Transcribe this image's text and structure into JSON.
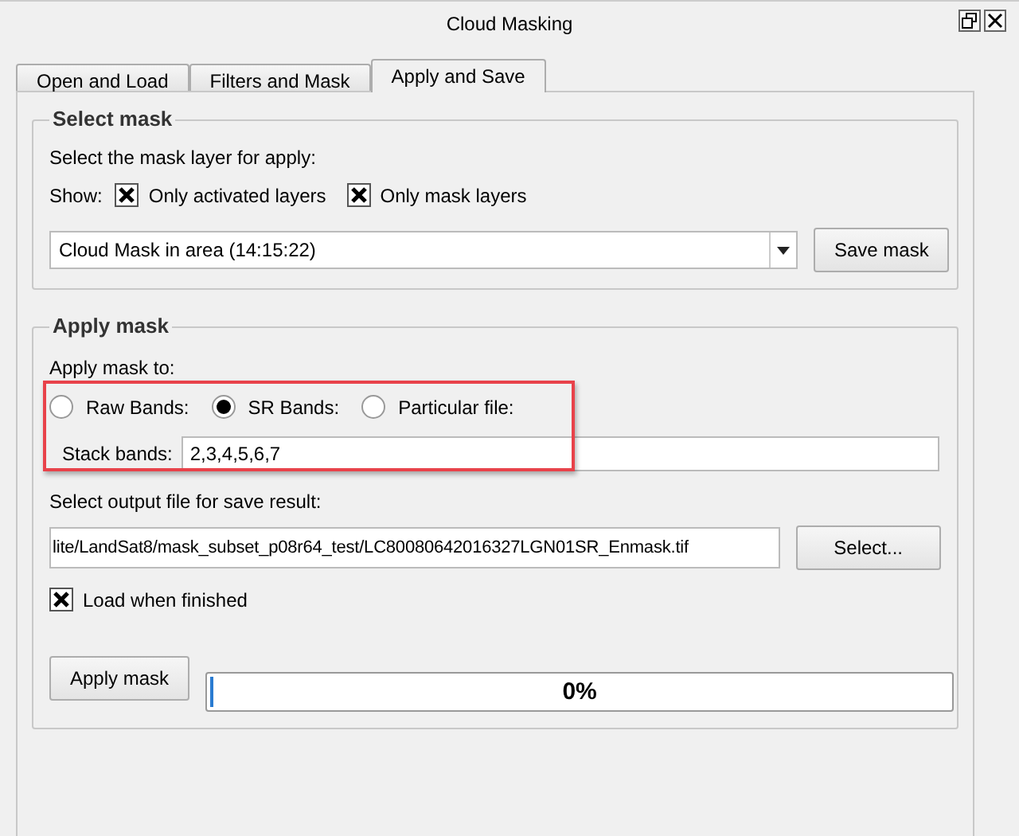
{
  "window": {
    "title": "Cloud Masking"
  },
  "tabs": [
    {
      "label": "Open and Load",
      "selected": false
    },
    {
      "label": "Filters and Mask",
      "selected": false
    },
    {
      "label": "Apply and Save",
      "selected": true
    }
  ],
  "select_mask": {
    "title": "Select mask",
    "prompt": "Select the mask layer for apply:",
    "show_label": "Show:",
    "filters": [
      {
        "label": "Only activated layers",
        "checked": true
      },
      {
        "label": "Only mask layers",
        "checked": true
      }
    ],
    "layer_combo": {
      "value": "Cloud Mask in area (14:15:22)"
    },
    "save_button": "Save mask"
  },
  "apply_mask": {
    "title": "Apply mask",
    "prompt": "Apply mask to:",
    "targets": [
      {
        "label": "Raw Bands:",
        "selected": false
      },
      {
        "label": "SR Bands:",
        "selected": true
      },
      {
        "label": "Particular file:",
        "selected": false
      }
    ],
    "stack_bands": {
      "label": "Stack bands:",
      "value": "2,3,4,5,6,7"
    },
    "output_label": "Select output file for save result:",
    "output_file": {
      "value": "lite/LandSat8/mask_subset_p08r64_test/LC80080642016327LGN01SR_Enmask.tif"
    },
    "select_button": "Select...",
    "load_when_finished": {
      "label": "Load when finished",
      "checked": true
    },
    "apply_button": "Apply mask",
    "progress": {
      "level": 0,
      "reading": "0%"
    }
  }
}
